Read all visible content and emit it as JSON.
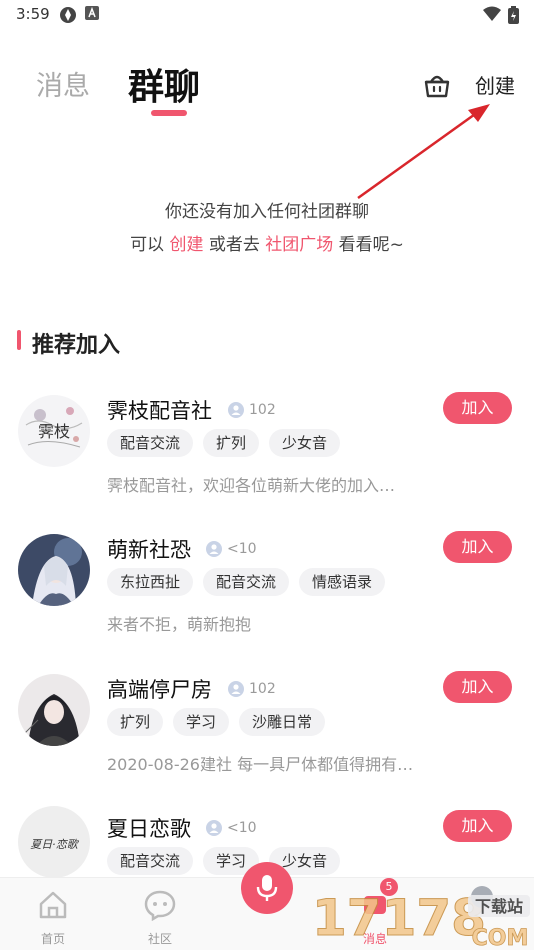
{
  "status_bar": {
    "time": "3:59"
  },
  "header": {
    "tab_messages": "消息",
    "tab_groups": "群聊",
    "create_label": "创建"
  },
  "empty_state": {
    "line1": "你还没有加入任何社团群聊",
    "line2_prefix": "可以 ",
    "line2_create": "创建",
    "line2_middle": " 或者去 ",
    "line2_plaza": "社团广场",
    "line2_suffix": " 看看呢~"
  },
  "recommend": {
    "title": "推荐加入",
    "join_label": "加入",
    "groups": [
      {
        "name": "霁枝配音社",
        "members": "102",
        "tags": [
          "配音交流",
          "扩列",
          "少女音"
        ],
        "desc": "霁枝配音社，欢迎各位萌新大佬的加入…"
      },
      {
        "name": "萌新社恐",
        "members": "<10",
        "tags": [
          "东拉西扯",
          "配音交流",
          "情感语录"
        ],
        "desc": "来者不拒，萌新抱抱"
      },
      {
        "name": "高端停尸房",
        "members": "102",
        "tags": [
          "扩列",
          "学习",
          "沙雕日常"
        ],
        "desc": "2020-08-26建社 每一具尸体都值得拥有…"
      },
      {
        "name": "夏日恋歌",
        "members": "<10",
        "tags": [
          "配音交流",
          "学习",
          "少女音"
        ],
        "desc": ""
      }
    ],
    "avatar_text_1": "霁枝",
    "avatar_text_4": "夏日·恋歌"
  },
  "bottom_nav": {
    "home": "首页",
    "community": "社区",
    "messages": "消息",
    "badge_count": "5"
  },
  "watermark": {
    "number": "17178",
    "site": "下载站",
    "suffix": "COM"
  },
  "colors": {
    "accent": "#f0566e",
    "tag_bg": "#f2f2f4",
    "muted": "#999999"
  }
}
